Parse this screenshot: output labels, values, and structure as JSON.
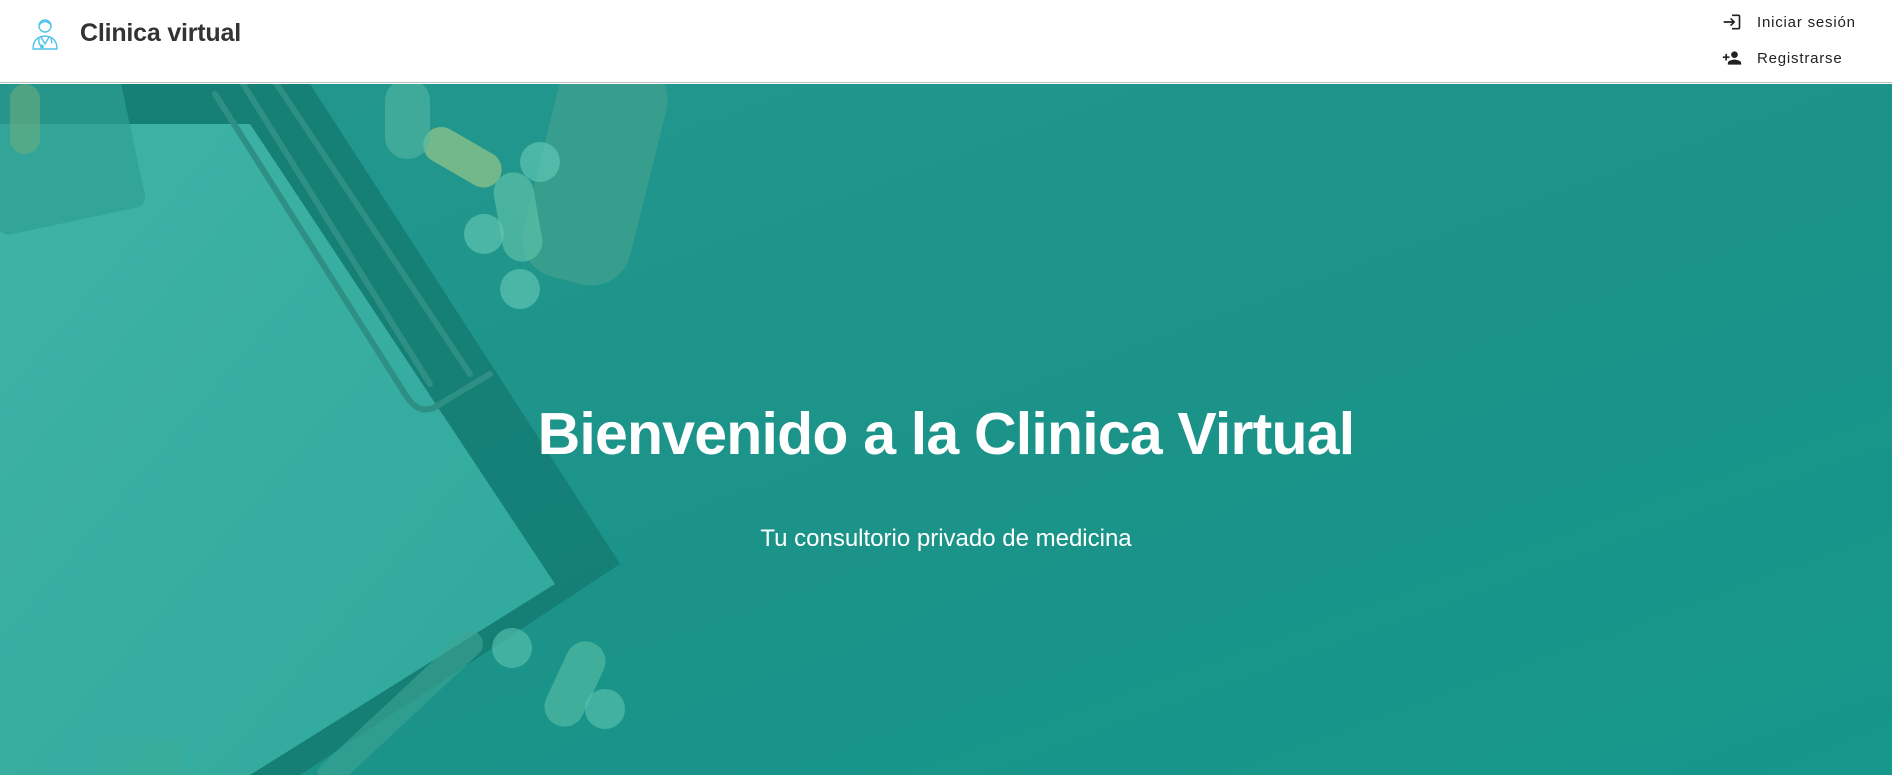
{
  "header": {
    "brand_icon": "doctor-avatar-icon",
    "brand_title": "Clinica virtual",
    "nav": [
      {
        "label": "Iniciar sesión",
        "icon": "login-icon"
      },
      {
        "label": "Registrarse",
        "icon": "person-add-icon"
      }
    ]
  },
  "hero": {
    "title": "Bienvenido a la Clinica Virtual",
    "subtitle": "Tu consultorio privado de medicina",
    "background": "clipboard-pills-photo",
    "overlay_color": "#1a9389"
  },
  "colors": {
    "header_bg": "#ffffff",
    "brand_text": "#333333",
    "nav_text": "#222222",
    "hero_text": "#ffffff",
    "brand_icon": "#4fc3e8"
  }
}
